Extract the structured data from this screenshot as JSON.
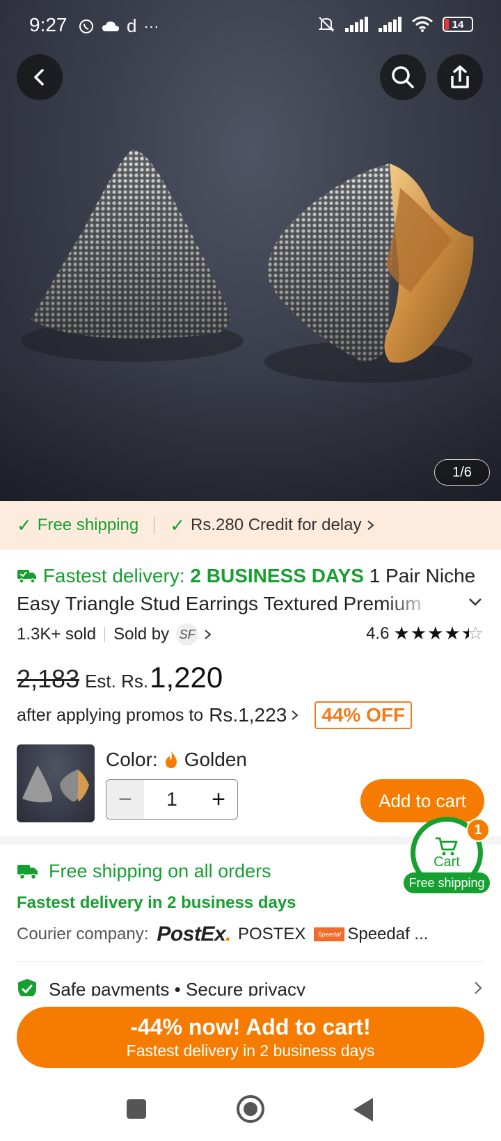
{
  "status_bar": {
    "time": "9:27",
    "left_icons": [
      "whatsapp-icon",
      "cloud-icon",
      "d-icon",
      "more-icon"
    ],
    "right_icons": [
      "mute-bell-icon",
      "signal-icon",
      "signal-icon",
      "wifi-icon"
    ],
    "battery": "14"
  },
  "hero": {
    "image_counter": "1/6"
  },
  "promo_strip": {
    "free_shipping": "Free shipping",
    "credit": "Rs.280 Credit for delay"
  },
  "product": {
    "fast_label": "Fastest delivery: ",
    "fast_days": "2 BUSINESS DAYS",
    "title_line1_rest": " 1 Pair Niche",
    "title_line2": "Easy Triangle Stud Earrings Textured Premium",
    "sold": "1.3K+ sold",
    "sold_by": "Sold by",
    "seller_badge": "SF",
    "rating": "4.6",
    "rating_value": 4.6
  },
  "price": {
    "old": "2,183",
    "est_label": "Est. Rs.",
    "new": "1,220",
    "promo_text": "after applying promos to",
    "promo_amount": "Rs.1,223",
    "off_badge": "44% OFF"
  },
  "selection": {
    "color_label": "Color:",
    "color_value": "Golden",
    "quantity": "1",
    "minus": "−",
    "plus": "+",
    "add_to_cart": "Add to cart"
  },
  "shipping": {
    "title": "Free shipping on all orders",
    "fast": "Fastest delivery in 2 business days",
    "courier_label": "Courier company:",
    "postex_logo": "PostEx",
    "postex_name": "POSTEX",
    "speedaf_logo": "Speedaf",
    "speedaf_name": "Speedaf ..."
  },
  "cart_float": {
    "label": "Cart",
    "count": "1",
    "free": "Free shipping"
  },
  "safety": {
    "text": "Safe payments • Secure privacy"
  },
  "cta": {
    "line1": "-44% now! Add to cart!",
    "line2": "Fastest delivery in 2 business days"
  },
  "colors": {
    "accent_orange": "#f57c00",
    "green": "#16a02f",
    "promo_bg": "#fdebdd"
  }
}
